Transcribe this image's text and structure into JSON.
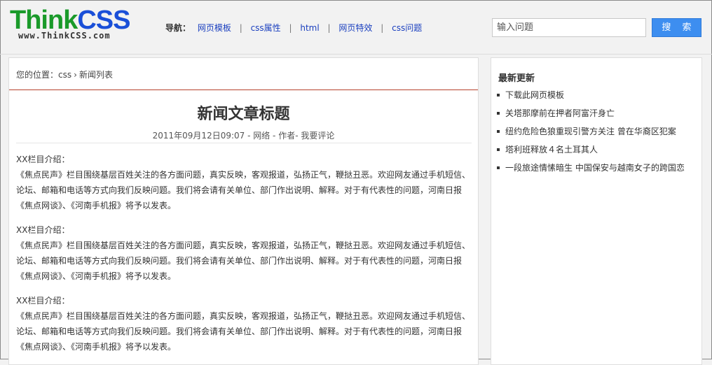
{
  "header": {
    "logo_main_think": "Think",
    "logo_main_css": "CSS",
    "logo_url": "www.ThinkCSS.com",
    "nav_label": "导航：",
    "nav_items": [
      "网页模板",
      "css属性",
      "html",
      "网页特效",
      "css问题"
    ],
    "nav_separator": "|",
    "search_placeholder": "输入问题",
    "search_button": "搜 索"
  },
  "breadcrumb": {
    "prefix": "您的位置：",
    "items": [
      "css",
      "新闻列表"
    ],
    "separator": "›"
  },
  "article": {
    "title": "新闻文章标题",
    "meta": "2011年09月12日09:07 - 网络 - 作者- 我要评论",
    "paragraphs": [
      {
        "heading": "XX栏目介绍：",
        "body": "《焦点民声》栏目围绕基层百姓关注的各方面问题，真实反映，客观报道，弘扬正气，鞭挞丑恶。欢迎网友通过手机短信、论坛、邮箱和电话等方式向我们反映问题。我们将会请有关单位、部门作出说明、解释。对于有代表性的问题，河南日报《焦点网谈》、《河南手机报》将予以发表。"
      },
      {
        "heading": "XX栏目介绍：",
        "body": "《焦点民声》栏目围绕基层百姓关注的各方面问题，真实反映，客观报道，弘扬正气，鞭挞丑恶。欢迎网友通过手机短信、论坛、邮箱和电话等方式向我们反映问题。我们将会请有关单位、部门作出说明、解释。对于有代表性的问题，河南日报《焦点网谈》、《河南手机报》将予以发表。"
      },
      {
        "heading": "XX栏目介绍：",
        "body": "《焦点民声》栏目围绕基层百姓关注的各方面问题，真实反映，客观报道，弘扬正气，鞭挞丑恶。欢迎网友通过手机短信、论坛、邮箱和电话等方式向我们反映问题。我们将会请有关单位、部门作出说明、解释。对于有代表性的问题，河南日报《焦点网谈》、《河南手机报》将予以发表。"
      }
    ]
  },
  "sidebar": {
    "title": "最新更新",
    "items": [
      "下载此网页模板",
      "关塔那摩前在押者阿富汗身亡",
      "纽约危险色狼重现引警方关注 曾在华裔区犯案",
      "塔利班释放４名土耳其人",
      "一段旅途情愫暗生 中国保安与越南女子的跨国恋"
    ]
  },
  "colors": {
    "logo_think": "#1a9a2a",
    "logo_css": "#1a4fd8",
    "link": "#1a3fbf",
    "search_button": "#3d8ef0",
    "breadcrumb_rule": "#b5412b"
  }
}
